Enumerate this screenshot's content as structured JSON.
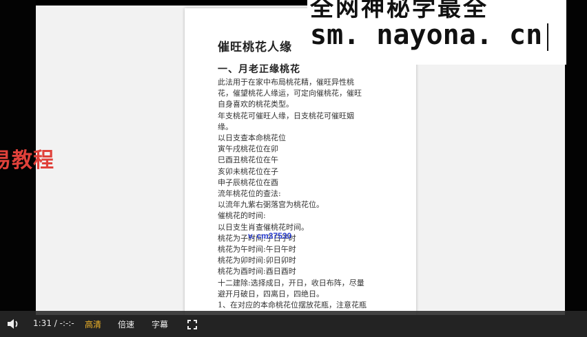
{
  "document": {
    "title": "催旺桃花人缘",
    "section": "一、月老正缘桃花",
    "lines": [
      "此法用于在家中布局桃花精，催旺异性桃",
      "花，催望桃花人缘运，可定向催桃花，催旺",
      "自身喜欢的桃花类型。",
      "年支桃花可催旺人缘，日支桃花可催旺姻",
      "缘。",
      "以日支查本命桃花位",
      "寅午戌桃花位在卯",
      "巳酉丑桃花位在午",
      "亥卯未桃花位在子",
      "申子辰桃花位在酉",
      "流年桃花位的查法:",
      "以流年九紫右弼落宫为桃花位。",
      "催桃花的时间:",
      "以日支生肖查催桃花时间。",
      "桃花为子时间:子日子时",
      "桃花为午时间:午日午时",
      "桃花为卯时间:卯日卯时",
      "桃花为酉时间:酉日酉时",
      "十二建除:选择成日，开日，收日布阵，尽量",
      "避开月破日，四离日，四绝日。",
      "1、在对应的本命桃花位摆放花瓶，注意花瓶"
    ]
  },
  "overlay_contact": "v. cm37530",
  "brand_badge": "易教程",
  "watermark": {
    "top_line": "全网神秘学最全",
    "url": "sm. nayona. cn"
  },
  "player": {
    "time": "1:31 / -:-:-",
    "quality_label": "高清",
    "speed_label": "倍速",
    "subtitle_label": "字幕",
    "volume_icon": "volume-icon",
    "fullscreen_icon": "fullscreen-icon"
  },
  "colors": {
    "accent_quality": "#f0b429",
    "badge_red": "#e0413a",
    "overlay_blue": "#2b3fd0"
  }
}
